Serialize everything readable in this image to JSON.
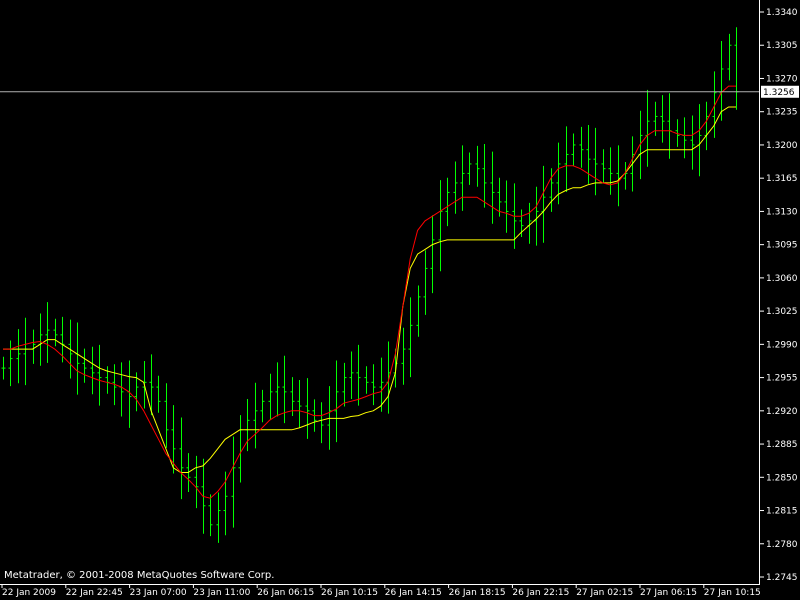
{
  "watermark": "Metatrader, © 2001-2008 MetaQuotes Software Corp.",
  "colors": {
    "background": "#000000",
    "candle": "#00ff00",
    "ma_fast": "#ff0000",
    "ma_slow": "#ffff00",
    "axis": "#ffffff",
    "price_line": "#b0b0b0"
  },
  "chart_data": {
    "type": "line",
    "grid": false,
    "ylim": [
      1.2745,
      1.334
    ],
    "y_ticks": [
      "1.3340",
      "1.3305",
      "1.3270",
      "1.3235",
      "1.3200",
      "1.3165",
      "1.3130",
      "1.3095",
      "1.3060",
      "1.3025",
      "1.2990",
      "1.2955",
      "1.2920",
      "1.2885",
      "1.2850",
      "1.2815",
      "1.2780",
      "1.2745"
    ],
    "x_ticks": [
      "22 Jan 2009",
      "22 Jan 22:45",
      "23 Jan 07:00",
      "23 Jan 11:00",
      "26 Jan 06:15",
      "26 Jan 10:15",
      "26 Jan 14:15",
      "26 Jan 18:15",
      "26 Jan 22:15",
      "27 Jan 02:15",
      "27 Jan 06:15",
      "27 Jan 10:15"
    ],
    "current_price": "1.3256",
    "current_price_value": 1.3256,
    "close": [
      1.2965,
      1.2975,
      1.298,
      1.2985,
      1.299,
      1.3,
      1.3005,
      1.3,
      1.299,
      1.298,
      1.297,
      1.2965,
      1.296,
      1.2955,
      1.295,
      1.2945,
      1.294,
      1.2935,
      1.2945,
      1.295,
      1.2945,
      1.293,
      1.29,
      1.288,
      1.286,
      1.285,
      1.284,
      1.282,
      1.28,
      1.2815,
      1.283,
      1.286,
      1.29,
      1.291,
      1.292,
      1.293,
      1.294,
      1.2945,
      1.294,
      1.293,
      1.2925,
      1.292,
      1.291,
      1.2905,
      1.292,
      1.294,
      1.2955,
      1.296,
      1.2955,
      1.295,
      1.2945,
      1.295,
      1.296,
      1.297,
      1.2985,
      1.301,
      1.304,
      1.307,
      1.31,
      1.313,
      1.315,
      1.316,
      1.317,
      1.318,
      1.3175,
      1.316,
      1.315,
      1.314,
      1.313,
      1.312,
      1.3115,
      1.312,
      1.313,
      1.3145,
      1.316,
      1.318,
      1.319,
      1.32,
      1.3195,
      1.3185,
      1.318,
      1.3175,
      1.317,
      1.3165,
      1.317,
      1.319,
      1.321,
      1.3225,
      1.323,
      1.3225,
      1.3215,
      1.321,
      1.3205,
      1.32,
      1.321,
      1.323,
      1.3255,
      1.328,
      1.3305,
      1.3256
    ],
    "series": [
      {
        "values": [
          1.2985,
          1.2985,
          1.2988,
          1.299,
          1.2992,
          1.2993,
          1.299,
          1.2985,
          1.2978,
          1.297,
          1.2962,
          1.2958,
          1.2955,
          1.2952,
          1.295,
          1.2948,
          1.2945,
          1.294,
          1.2932,
          1.292,
          1.2905,
          1.289,
          1.2875,
          1.2865,
          1.2855,
          1.2848,
          1.284,
          1.283,
          1.2828,
          1.2835,
          1.2845,
          1.286,
          1.2875,
          1.2888,
          1.2895,
          1.2902,
          1.291,
          1.2915,
          1.2918,
          1.292,
          1.292,
          1.2918,
          1.2915,
          1.2915,
          1.2918,
          1.2922,
          1.2928,
          1.293,
          1.2932,
          1.2935,
          1.2938,
          1.294,
          1.295,
          1.298,
          1.303,
          1.308,
          1.311,
          1.312,
          1.3125,
          1.313,
          1.3135,
          1.314,
          1.3145,
          1.3145,
          1.3145,
          1.314,
          1.3135,
          1.313,
          1.3128,
          1.3125,
          1.3125,
          1.3128,
          1.3135,
          1.315,
          1.3165,
          1.3175,
          1.3178,
          1.3178,
          1.3175,
          1.317,
          1.3165,
          1.316,
          1.3158,
          1.316,
          1.317,
          1.3185,
          1.32,
          1.321,
          1.3215,
          1.3215,
          1.3215,
          1.3212,
          1.321,
          1.321,
          1.3215,
          1.3225,
          1.324,
          1.3255,
          1.3262,
          1.3262
        ]
      },
      {
        "values": [
          1.2985,
          1.2985,
          1.2985,
          1.2985,
          1.2985,
          1.299,
          1.2995,
          1.2995,
          1.299,
          1.2985,
          1.298,
          1.2975,
          1.297,
          1.2965,
          1.2962,
          1.296,
          1.2958,
          1.2956,
          1.2955,
          1.295,
          1.292,
          1.29,
          1.288,
          1.286,
          1.2855,
          1.2855,
          1.286,
          1.2862,
          1.287,
          1.288,
          1.289,
          1.2895,
          1.29,
          1.29,
          1.29,
          1.29,
          1.29,
          1.29,
          1.29,
          1.29,
          1.2902,
          1.2905,
          1.2908,
          1.291,
          1.2912,
          1.2912,
          1.2912,
          1.2914,
          1.2915,
          1.2918,
          1.292,
          1.2925,
          1.2935,
          1.296,
          1.303,
          1.307,
          1.3085,
          1.309,
          1.3095,
          1.3098,
          1.31,
          1.31,
          1.31,
          1.31,
          1.31,
          1.31,
          1.31,
          1.31,
          1.31,
          1.31,
          1.3108,
          1.3115,
          1.3122,
          1.313,
          1.314,
          1.3148,
          1.3152,
          1.3155,
          1.3155,
          1.3158,
          1.316,
          1.316,
          1.316,
          1.3162,
          1.317,
          1.318,
          1.319,
          1.3195,
          1.3195,
          1.3195,
          1.3195,
          1.3195,
          1.3195,
          1.3195,
          1.32,
          1.321,
          1.322,
          1.3235,
          1.324,
          1.324
        ]
      }
    ]
  }
}
